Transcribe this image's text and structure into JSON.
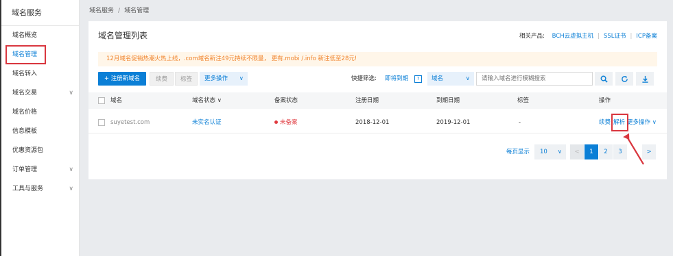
{
  "sidebar": {
    "title": "域名服务",
    "items": [
      {
        "label": "域名概览",
        "chevron": ""
      },
      {
        "label": "域名管理",
        "chevron": ""
      },
      {
        "label": "域名转入",
        "chevron": ""
      },
      {
        "label": "域名交易",
        "chevron": "∨"
      },
      {
        "label": "域名价格",
        "chevron": ""
      },
      {
        "label": "信息模板",
        "chevron": ""
      },
      {
        "label": "优惠资源包",
        "chevron": ""
      },
      {
        "label": "订单管理",
        "chevron": "∨"
      },
      {
        "label": "工具与服务",
        "chevron": "∨"
      }
    ]
  },
  "breadcrumb": {
    "root": "域名服务",
    "separator": "/",
    "current": "域名管理"
  },
  "panel": {
    "title": "域名管理列表",
    "related_label": "相关产品:",
    "related_links": [
      "BCH云虚拟主机",
      "SSL证书",
      "ICP备案"
    ],
    "link_separator": "|"
  },
  "notice": "12月域名促销热潮火热上线，.com域名新注49元持续不限量，  更有.mobi /.info 新注低至28元!",
  "toolbar": {
    "register_label": "+ 注册新域名",
    "renew_label": "续费",
    "tag_label": "标签",
    "more_label": "更多操作",
    "more_chevron": "∨",
    "quick_filter_label": "快捷筛选:",
    "quick_filter_link": "即将到期",
    "help_glyph": "?",
    "type_select": "域名",
    "search_placeholder": "请输入域名进行模糊搜索"
  },
  "table": {
    "headers": [
      "域名",
      "域名状态",
      "备案状态",
      "注册日期",
      "到期日期",
      "标签",
      "操作"
    ],
    "status_sort_glyph": "∨",
    "rows": [
      {
        "domain": "suyetest.com",
        "domain_status": "未实名认证",
        "filing_status": "未备案",
        "registered": "2018-12-01",
        "expires": "2019-12-01",
        "tag": "-",
        "actions": {
          "renew": "续费",
          "resolve": "解析",
          "more": "更多操作",
          "more_chevron": "∨"
        }
      }
    ]
  },
  "pagination": {
    "per_page_label": "每页显示",
    "page_size": "10",
    "prev": "<",
    "pages": [
      "1",
      "2",
      "3"
    ],
    "current_page": "1",
    "next": ">"
  },
  "colors": {
    "accent": "#0b7fd6",
    "alert": "#e0393e",
    "notice_text": "#f0832b",
    "highlight": "#d9363e"
  }
}
